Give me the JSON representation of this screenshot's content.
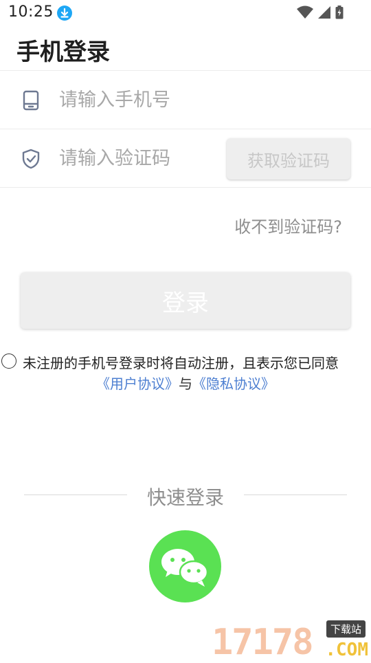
{
  "status_bar": {
    "time": "10:25"
  },
  "page": {
    "title": "手机登录"
  },
  "phone_field": {
    "placeholder": "请输入手机号",
    "value": ""
  },
  "code_field": {
    "placeholder": "请输入验证码",
    "value": "",
    "get_code_label": "获取验证码"
  },
  "no_code_link": "收不到验证码?",
  "login_button_label": "登录",
  "agreement": {
    "checked": false,
    "text": "未注册的手机号登录时将自动注册，且表示您已同意",
    "user_agreement": "《用户协议》",
    "and": "与",
    "privacy_agreement": "《隐私协议》"
  },
  "quick_login": {
    "title": "快速登录",
    "wechat_icon": "wechat-icon"
  },
  "watermark": {
    "number": "17178",
    "tag": "下载站",
    "domain": ".COM"
  },
  "colors": {
    "link": "#4d7fd1",
    "wechat": "#5ae153",
    "button_bg": "#eeeeee",
    "status_accent": "#1ea7f5"
  }
}
